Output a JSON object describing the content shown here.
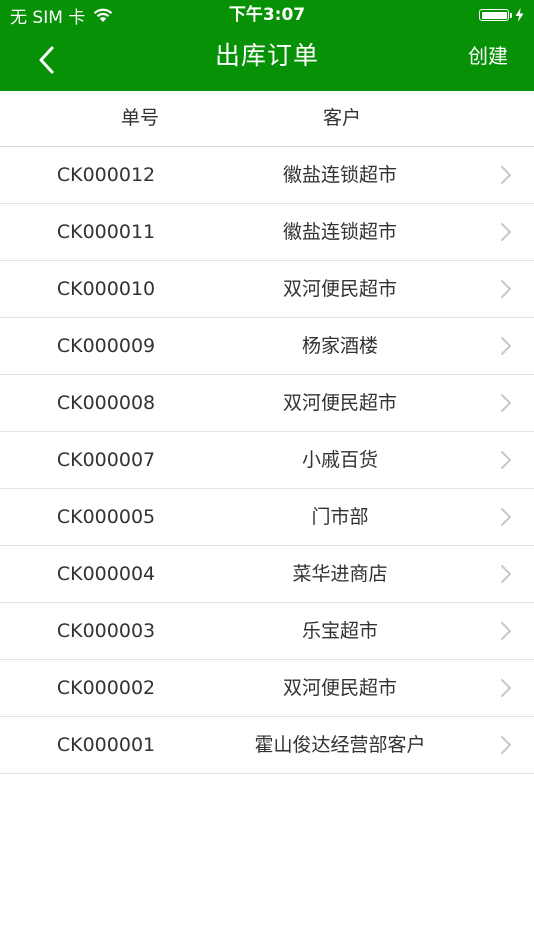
{
  "status_bar": {
    "carrier": "无 SIM 卡",
    "time": "下午3:07",
    "battery_level": 1.0,
    "wifi_icon": "wifi-icon",
    "battery_icon": "battery-icon",
    "charging_icon": "bolt-icon"
  },
  "nav": {
    "back_icon": "chevron-left-icon",
    "title": "出库订单",
    "create_label": "创建"
  },
  "table": {
    "headers": {
      "order_no": "单号",
      "customer": "客户"
    },
    "rows": [
      {
        "order_no": "CK000012",
        "customer": "徽盐连锁超市"
      },
      {
        "order_no": "CK000011",
        "customer": "徽盐连锁超市"
      },
      {
        "order_no": "CK000010",
        "customer": "双河便民超市"
      },
      {
        "order_no": "CK000009",
        "customer": "杨家酒楼"
      },
      {
        "order_no": "CK000008",
        "customer": "双河便民超市"
      },
      {
        "order_no": "CK000007",
        "customer": "小戚百货"
      },
      {
        "order_no": "CK000005",
        "customer": "门市部"
      },
      {
        "order_no": "CK000004",
        "customer": "菜华进商店"
      },
      {
        "order_no": "CK000003",
        "customer": "乐宝超市"
      },
      {
        "order_no": "CK000002",
        "customer": "双河便民超市"
      },
      {
        "order_no": "CK000001",
        "customer": "霍山俊达经营部客户"
      }
    ]
  },
  "colors": {
    "brand_green": "#069106",
    "text": "#333333",
    "divider": "#e3e3e3",
    "chevron": "#c7c7cc"
  }
}
